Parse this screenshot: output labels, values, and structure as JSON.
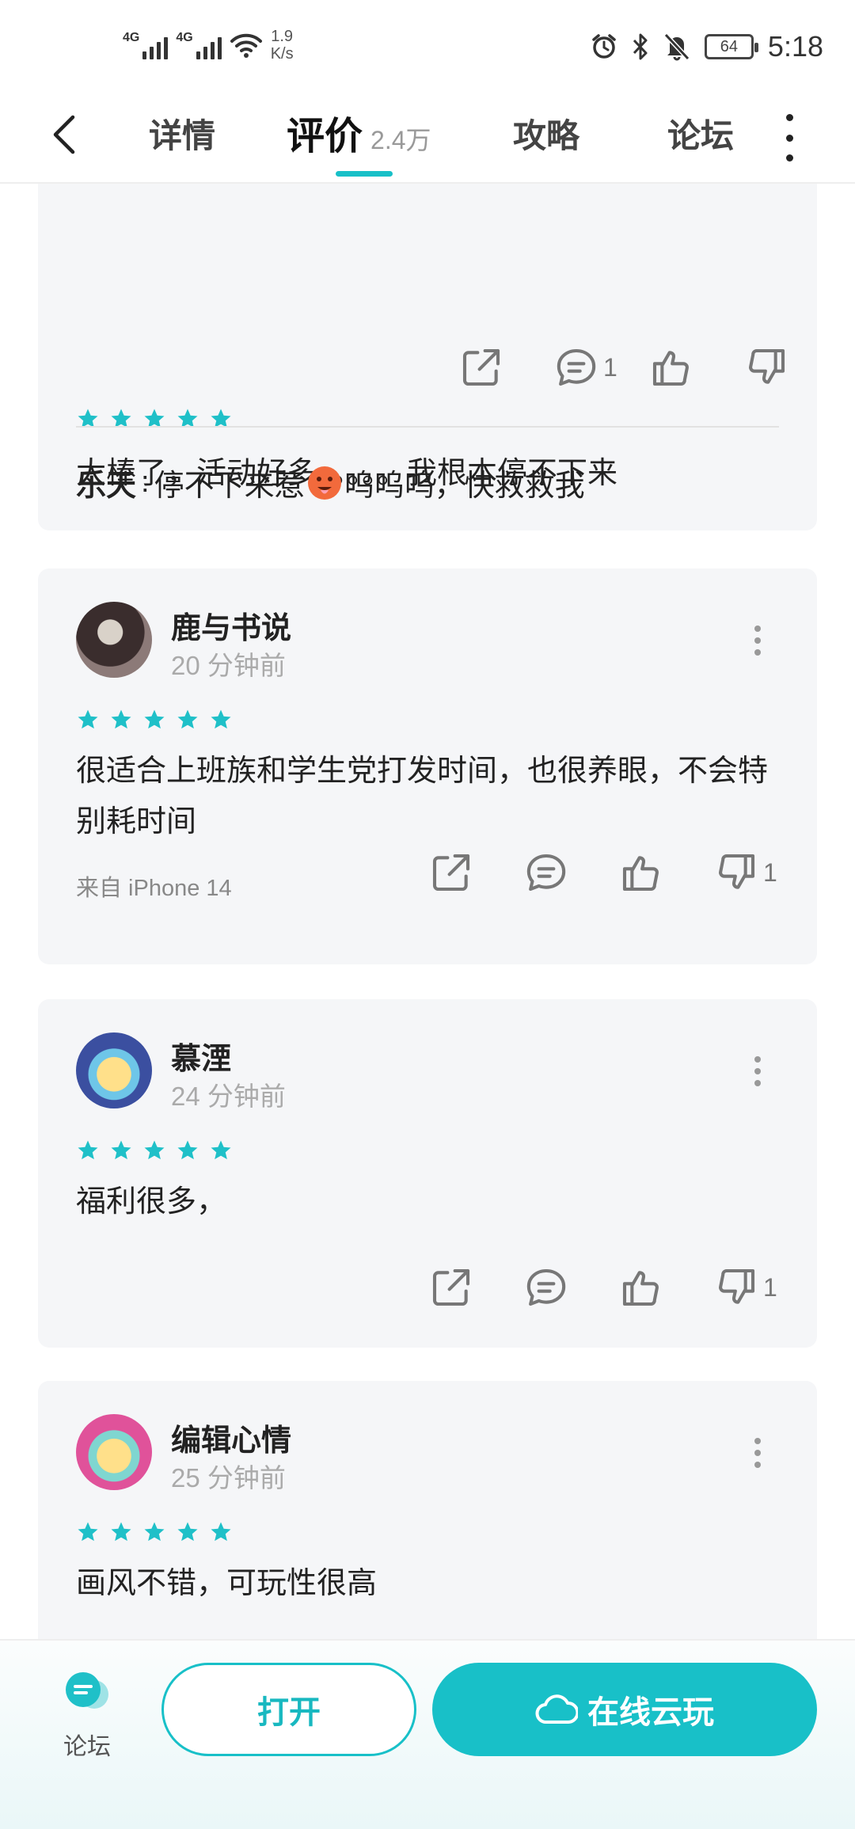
{
  "status_bar": {
    "net1": "4G",
    "net2": "4G",
    "speed_value": "1.9",
    "speed_unit": "K/s",
    "battery": "64",
    "time": "5:18"
  },
  "nav": {
    "tab_details": "详情",
    "tab_reviews": "评价",
    "reviews_count": "2.4万",
    "tab_guides": "攻略",
    "tab_forum": "论坛"
  },
  "accent_color": "#18c0c8",
  "reviews": [
    {
      "body": "太棒了，活动好多。。。。。我根本停不下来",
      "rating": 5,
      "comments": "1",
      "reply": {
        "user": "乐天",
        "sep": ":",
        "text_a": "停不下来惹",
        "emoji": "face-with-tongue",
        "text_b": "呜呜呜，快救救我"
      }
    },
    {
      "user": "鹿与书说",
      "time": "20 分钟前",
      "rating": 5,
      "body": "很适合上班族和学生党打发时间，也很养眼，不会特别耗时间",
      "device": "来自 iPhone 14",
      "dislikes": "1"
    },
    {
      "user": "慕湮",
      "time": "24 分钟前",
      "rating": 5,
      "body": "福利很多，",
      "dislikes": "1"
    },
    {
      "user": "编辑心情",
      "time": "25 分钟前",
      "rating": 5,
      "body": "画风不错，可玩性很高"
    }
  ],
  "bottom_bar": {
    "forum_label": "论坛",
    "open_label": "打开",
    "cloud_label": "在线云玩"
  },
  "icons": [
    "back-icon",
    "more-icon",
    "share-icon",
    "comment-icon",
    "thumb-up-icon",
    "thumb-down-icon",
    "star-icon",
    "cloud-icon",
    "forum-icon"
  ]
}
